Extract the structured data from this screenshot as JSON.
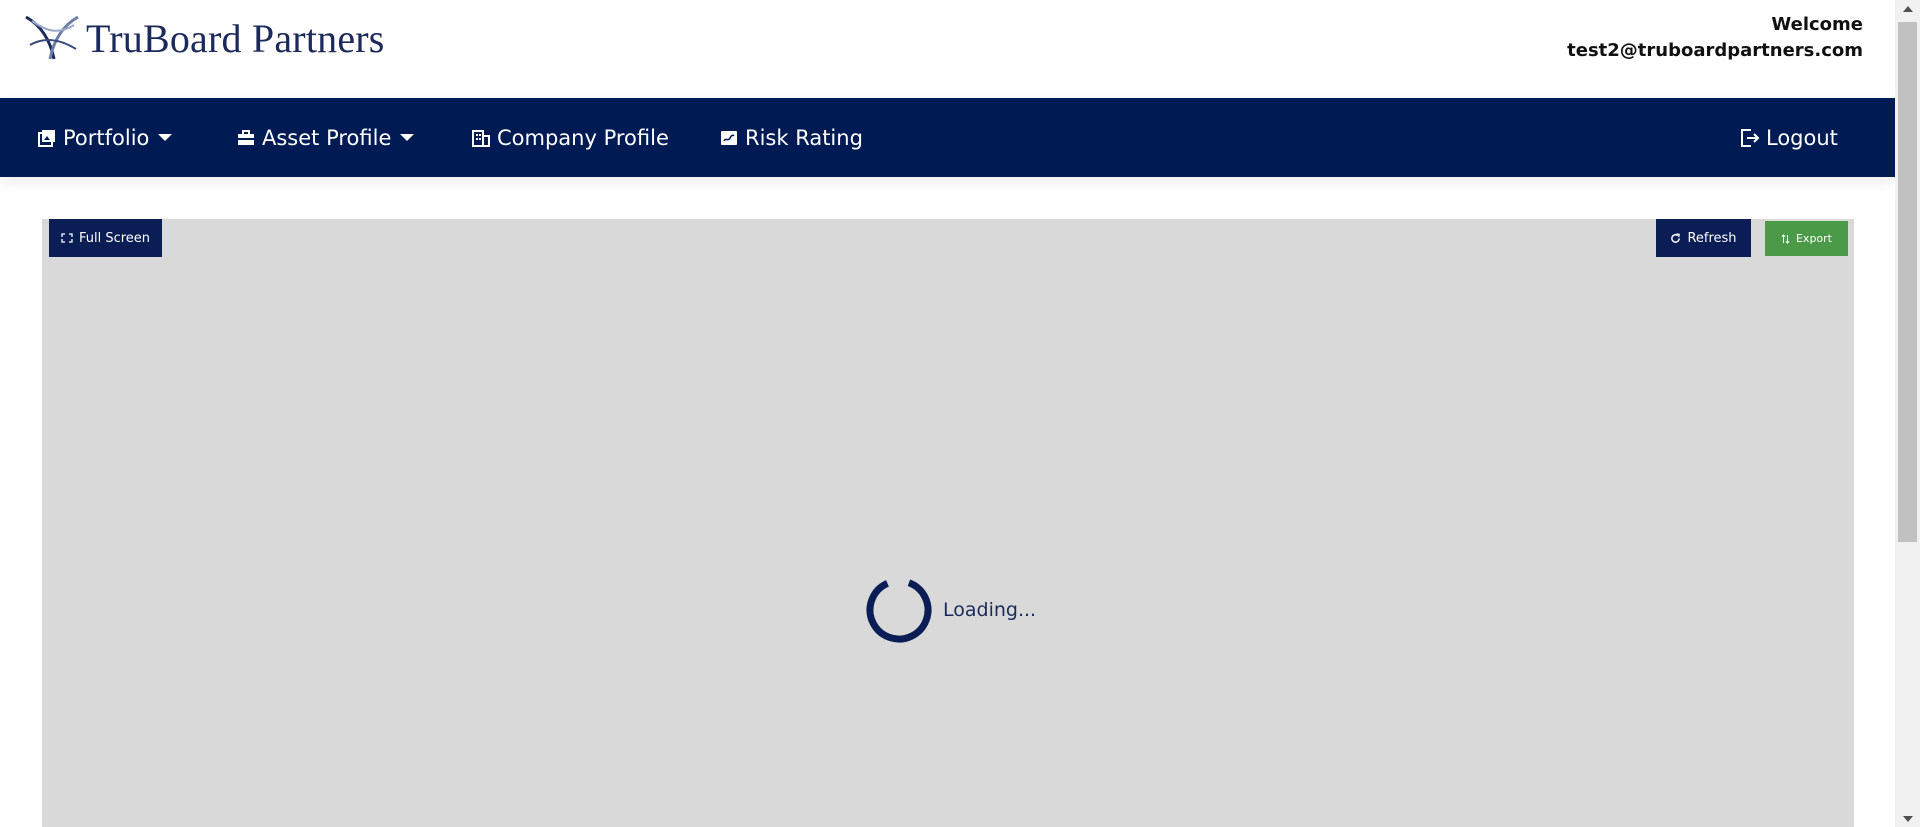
{
  "header": {
    "brand": "TruBoard Partners",
    "welcome_label": "Welcome",
    "user_email": "test2@truboardpartners.com"
  },
  "nav": {
    "items": [
      {
        "label": "Portfolio",
        "icon": "images-icon",
        "has_dropdown": true
      },
      {
        "label": "Asset Profile",
        "icon": "briefcase-icon",
        "has_dropdown": true
      },
      {
        "label": "Company Profile",
        "icon": "building-icon",
        "has_dropdown": false
      },
      {
        "label": "Risk Rating",
        "icon": "signature-icon",
        "has_dropdown": false
      }
    ],
    "logout_label": "Logout"
  },
  "toolbar": {
    "fullscreen_label": "Full Screen",
    "refresh_label": "Refresh",
    "export_label": "Export"
  },
  "content": {
    "loading_text": "Loading..."
  },
  "colors": {
    "nav_background": "#001b54",
    "panel_background": "#d9d9d9",
    "primary_button": "#0a1e55",
    "export_button": "#4a9a48",
    "brand_text": "#1b2a5a"
  }
}
